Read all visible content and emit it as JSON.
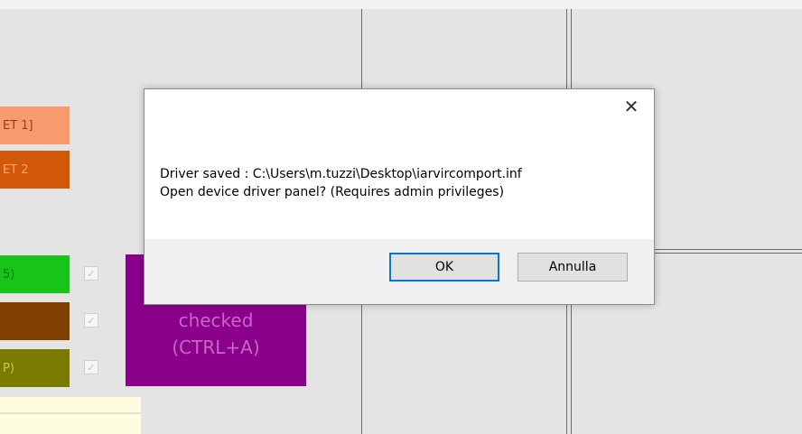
{
  "background": {
    "tags_top": [
      "ET 1]",
      "ET 2"
    ],
    "tags_colored": [
      "5)",
      "",
      "P)"
    ],
    "check_glyph": "✓",
    "purple_panel": {
      "line1": "checked",
      "line2": "(CTRL+A)"
    },
    "colors": {
      "orange_light": "#f79b6e",
      "orange_dark": "#d25707",
      "green": "#18c418",
      "brown": "#804000",
      "olive": "#7a7a00",
      "purple": "#8a008a"
    }
  },
  "dialog": {
    "close_glyph": "✕",
    "message_line1": "Driver saved : C:\\Users\\m.tuzzi\\Desktop\\iarvircomport.inf",
    "message_line2": "Open device driver panel? (Requires admin privileges)",
    "ok_label": "OK",
    "cancel_label": "Annulla"
  }
}
